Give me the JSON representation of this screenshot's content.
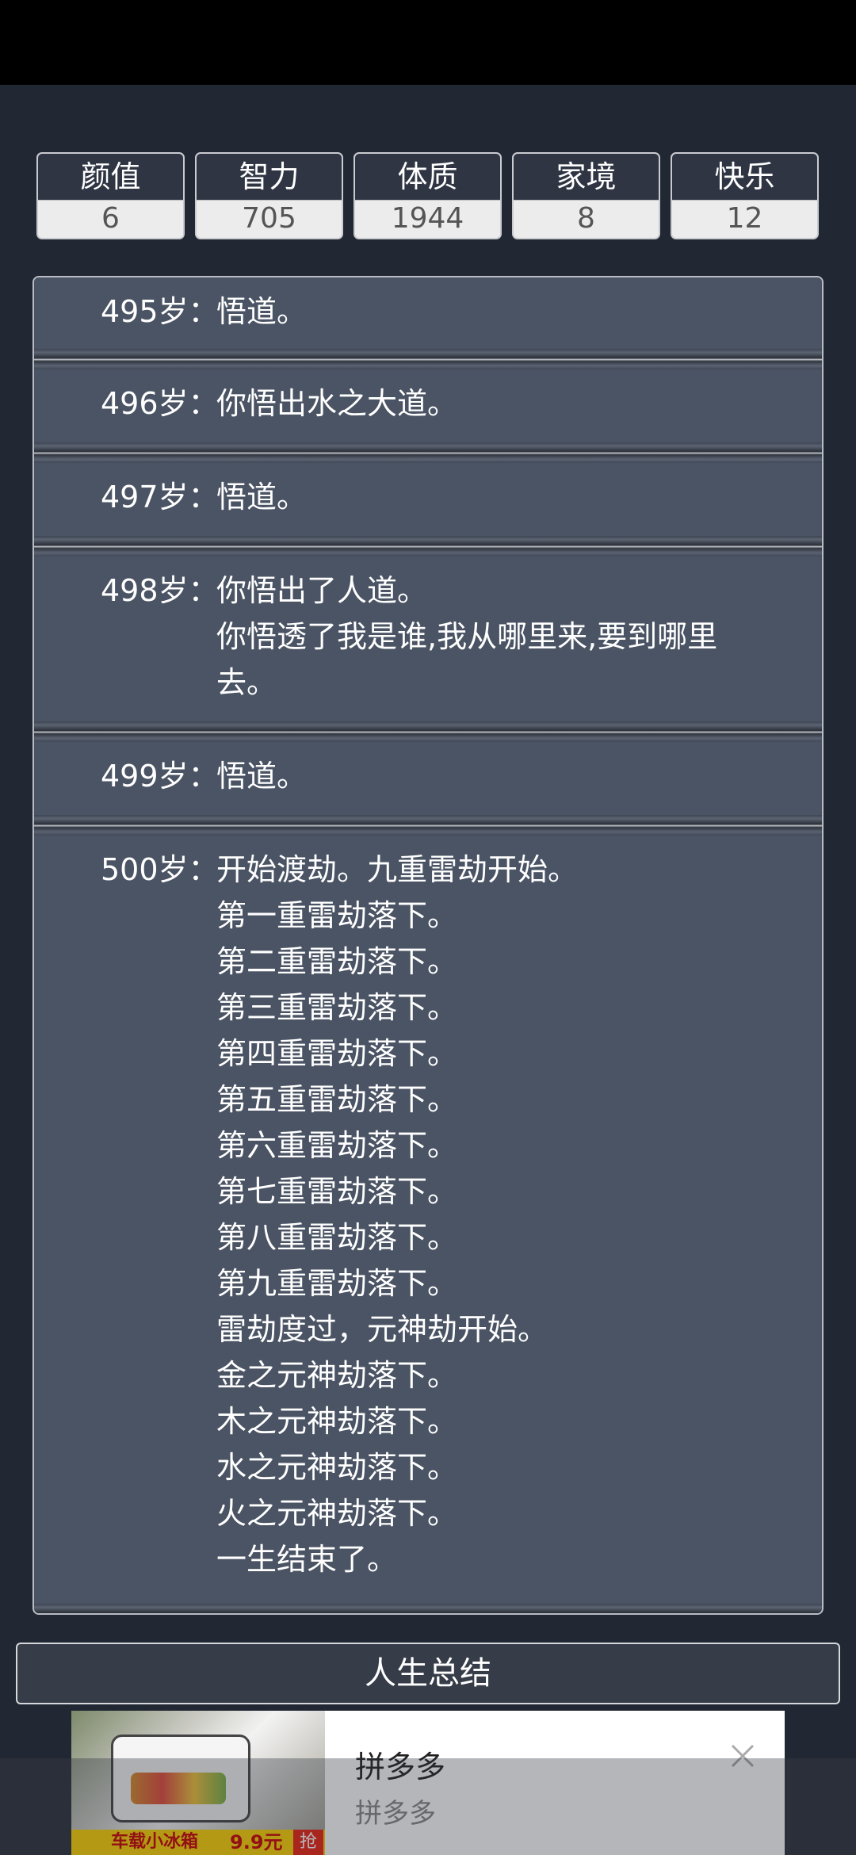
{
  "stats": [
    {
      "label": "颜值",
      "value": "6"
    },
    {
      "label": "智力",
      "value": "705"
    },
    {
      "label": "体质",
      "value": "1944"
    },
    {
      "label": "家境",
      "value": "8"
    },
    {
      "label": "快乐",
      "value": "12"
    }
  ],
  "log": [
    {
      "age": "495岁：",
      "lines": [
        "悟道。"
      ]
    },
    {
      "age": "496岁：",
      "lines": [
        "你悟出水之大道。"
      ]
    },
    {
      "age": "497岁：",
      "lines": [
        "悟道。"
      ]
    },
    {
      "age": "498岁：",
      "lines": [
        "你悟出了人道。",
        "你悟透了我是谁,我从哪里来,要到哪里",
        "去。"
      ]
    },
    {
      "age": "499岁：",
      "lines": [
        "悟道。"
      ]
    },
    {
      "age": "500岁：",
      "lines": [
        "开始渡劫。九重雷劫开始。",
        "第一重雷劫落下。",
        "第二重雷劫落下。",
        "第三重雷劫落下。",
        "第四重雷劫落下。",
        "第五重雷劫落下。",
        "第六重雷劫落下。",
        "第七重雷劫落下。",
        "第八重雷劫落下。",
        "第九重雷劫落下。",
        "雷劫度过，元神劫开始。",
        "金之元神劫落下。",
        "木之元神劫落下。",
        "水之元神劫落下。",
        "火之元神劫落下。",
        "一生结束了。"
      ]
    }
  ],
  "summary_button": "人生总结",
  "ad": {
    "title": "拼多多",
    "subtitle": "拼多多",
    "image_caption": "车载小冰箱",
    "image_price": "9.9元",
    "image_badge": "抢"
  },
  "colors": {
    "background": "#222833",
    "panel": "#4b5464",
    "stat_header": "#2f3543"
  },
  "icons": [
    "back-icon",
    "home-icon",
    "recent-apps-icon",
    "close-icon"
  ]
}
